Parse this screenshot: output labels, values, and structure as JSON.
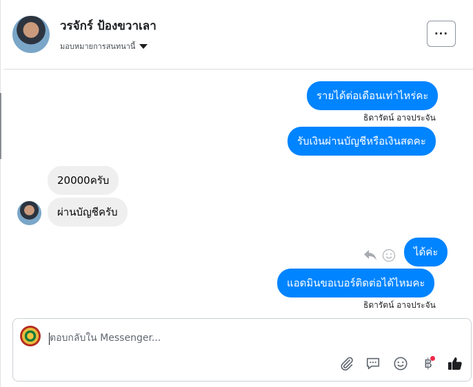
{
  "header": {
    "contact_name": "วรจักร์ ป้องขวาเลา",
    "assign_label": "มอบหมายการสนทนานี้",
    "more_label": "···"
  },
  "conversation": {
    "out_1": "รายได้ต่อเดือนเท่าไหร่คะ",
    "out_1_sender": "ธิดารัตน์ อาจประจัน",
    "out_2": "รับเงินผ่านบัญชีหรือเงินสดคะ",
    "in_1": "20000ครับ",
    "in_2": "ผ่านบัญชีครับ",
    "out_3": "ได้ค่ะ",
    "out_4": "แอดมินขอเบอร์ติดต่อได้ไหมคะ",
    "out_4_sender": "ธิดารัตน์ อาจประจัน"
  },
  "composer": {
    "placeholder": "ตอบกลับใน Messenger...",
    "baht_symbol": "฿"
  },
  "icons": {
    "reply": "reply-icon",
    "emoji_react": "smiley-icon",
    "attach": "paperclip-icon",
    "saved_replies": "chat-bubble-icon",
    "emoji": "smiley-icon",
    "payment": "baht-icon",
    "like": "thumbs-up-icon"
  },
  "colors": {
    "outgoing_bubble": "#0084ff",
    "incoming_bubble": "#efefef",
    "notification_dot": "#f02849"
  }
}
